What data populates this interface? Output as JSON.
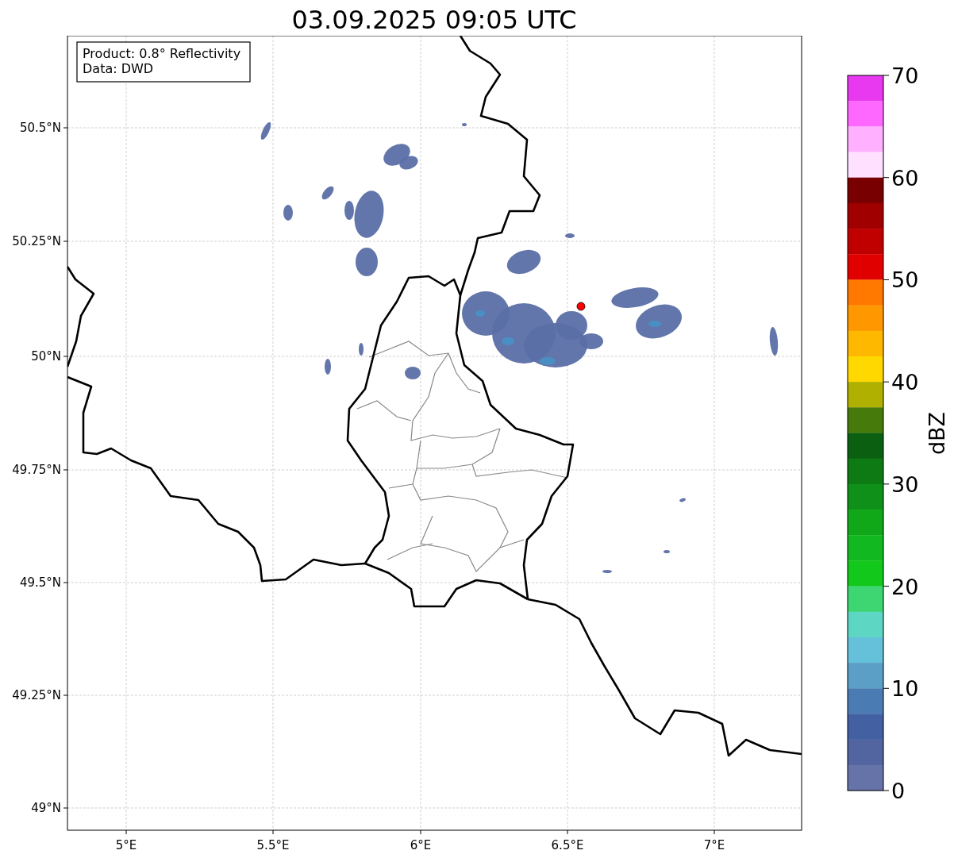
{
  "title": "03.09.2025 09:05 UTC",
  "info_box": [
    "Product: 0.8° Reflectivity",
    "Data: DWD"
  ],
  "map": {
    "lat_ticks": [
      "50.5°N",
      "50.25°N",
      "50°N",
      "49.75°N",
      "49.5°N",
      "49.25°N",
      "49°N"
    ],
    "lon_ticks": [
      "5°E",
      "5.5°E",
      "6°E",
      "6.5°E",
      "7°E"
    ]
  },
  "colorbar": {
    "label": "dBZ",
    "ticks": [
      "70",
      "60",
      "50",
      "40",
      "30",
      "20",
      "10",
      "0"
    ],
    "bins": [
      {
        "color": "#e838f0"
      },
      {
        "color": "#ff68ff"
      },
      {
        "color": "#ffb0ff"
      },
      {
        "color": "#ffe0ff"
      },
      {
        "color": "#780000"
      },
      {
        "color": "#a00000"
      },
      {
        "color": "#c00000"
      },
      {
        "color": "#e00000"
      },
      {
        "color": "#ff7800"
      },
      {
        "color": "#ff9800"
      },
      {
        "color": "#ffb800"
      },
      {
        "color": "#ffd800"
      },
      {
        "color": "#b0b000"
      },
      {
        "color": "#467a0a"
      },
      {
        "color": "#0a6010"
      },
      {
        "color": "#0d7a14"
      },
      {
        "color": "#0f9018"
      },
      {
        "color": "#10a818"
      },
      {
        "color": "#12b820"
      },
      {
        "color": "#12c81a"
      },
      {
        "color": "#3dd672"
      },
      {
        "color": "#5ed6c4"
      },
      {
        "color": "#65c0da"
      },
      {
        "color": "#5b9ec6"
      },
      {
        "color": "#4a7bb2"
      },
      {
        "color": "#4360a3"
      },
      {
        "color": "#5365a0"
      },
      {
        "color": "#6673a8"
      }
    ]
  }
}
